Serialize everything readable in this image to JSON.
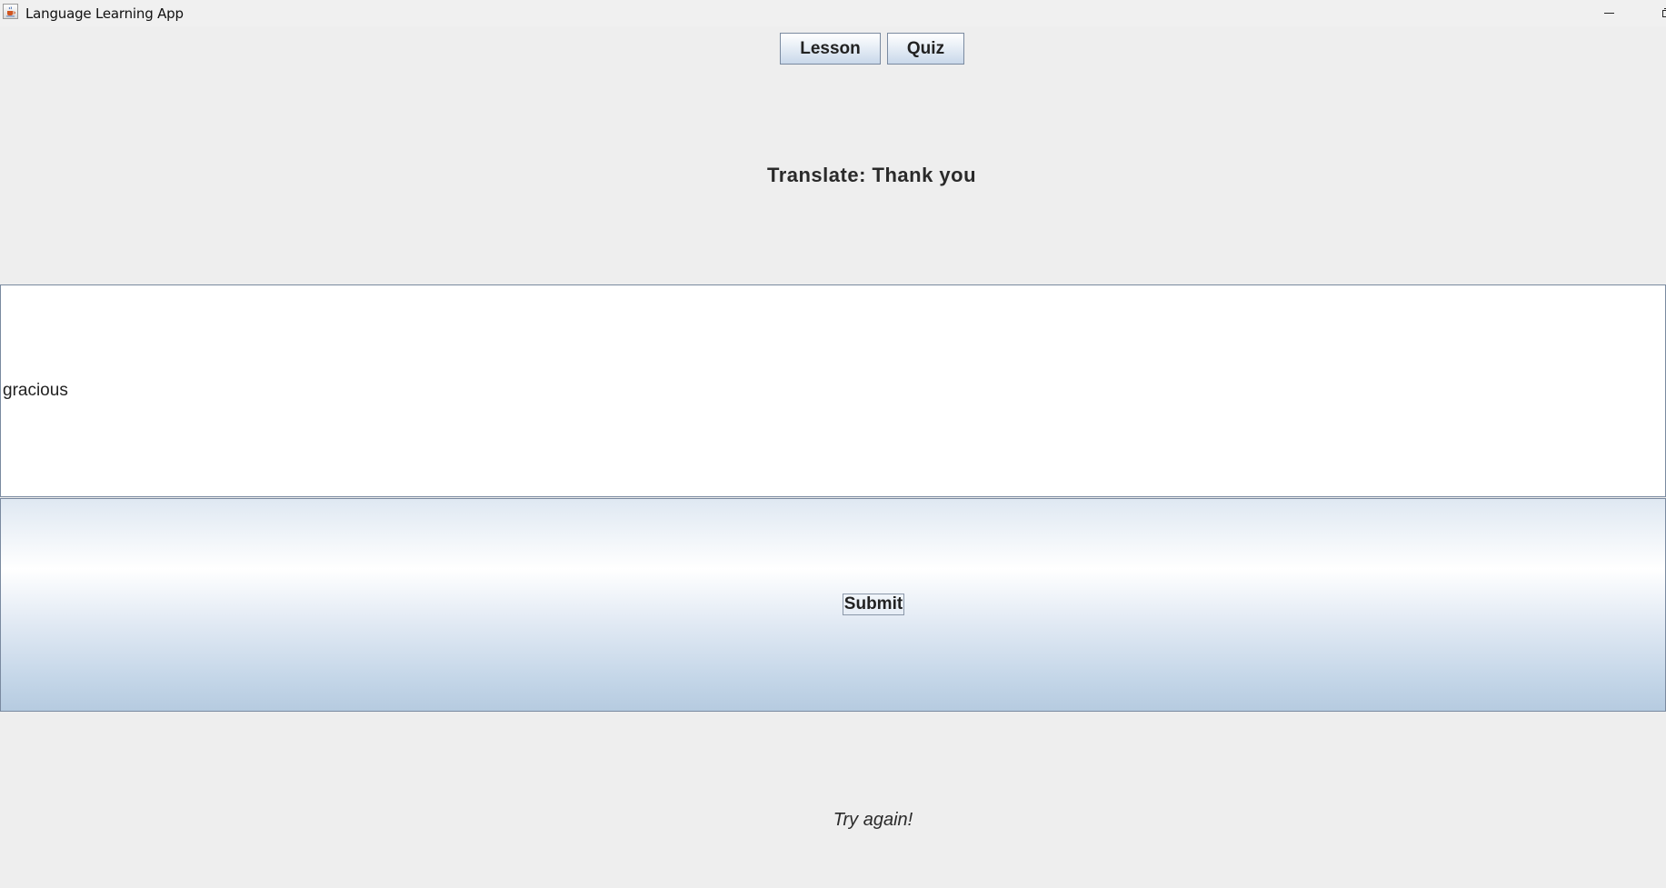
{
  "window": {
    "title": "Language Learning App"
  },
  "nav": {
    "lesson_label": "Lesson",
    "quiz_label": "Quiz"
  },
  "quiz": {
    "prompt": "Translate: Thank you",
    "answer_value": "gracious",
    "submit_label": "Submit",
    "feedback": "Try again!"
  },
  "colors": {
    "background": "#eeeeee",
    "button_border": "#7a8aa0",
    "text": "#222222"
  },
  "icons": {
    "app": "java-cup-icon",
    "minimize": "minimize-icon",
    "maximize": "maximize-icon"
  }
}
